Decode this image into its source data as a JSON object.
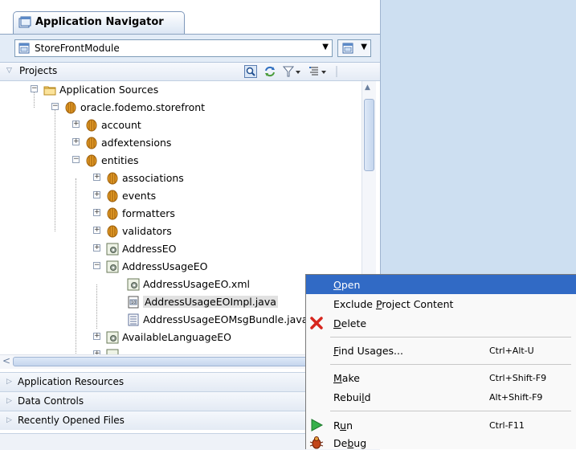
{
  "navigator": {
    "tab_title": "Application Navigator",
    "module": "StoreFrontModule",
    "projects_label": "Projects"
  },
  "tree": [
    {
      "label": "Application Sources",
      "icon": "folder-icon",
      "expanded": true
    },
    {
      "label": "oracle.fodemo.storefront",
      "icon": "package-icon",
      "expanded": true
    },
    {
      "label": "account",
      "icon": "package-icon",
      "expanded": false
    },
    {
      "label": "adfextensions",
      "icon": "package-icon",
      "expanded": false
    },
    {
      "label": "entities",
      "icon": "package-icon",
      "expanded": true
    },
    {
      "label": "associations",
      "icon": "package-icon",
      "expanded": false
    },
    {
      "label": "events",
      "icon": "package-icon",
      "expanded": false
    },
    {
      "label": "formatters",
      "icon": "package-icon",
      "expanded": false
    },
    {
      "label": "validators",
      "icon": "package-icon",
      "expanded": false
    },
    {
      "label": "AddressEO",
      "icon": "entity-object-icon",
      "expanded": false
    },
    {
      "label": "AddressUsageEO",
      "icon": "entity-object-icon",
      "expanded": true
    },
    {
      "label": "AddressUsageEO.xml",
      "icon": "xml-file-icon"
    },
    {
      "label": "AddressUsageEOImpl.java",
      "icon": "java-file-icon",
      "selected": true
    },
    {
      "label": "AddressUsageEOMsgBundle.java",
      "icon": "bundle-file-icon"
    },
    {
      "label": "AvailableLanguageEO",
      "icon": "entity-object-icon",
      "expanded": false
    },
    {
      "label": "...",
      "icon": "entity-object-icon",
      "expanded": false
    }
  ],
  "accordion": [
    {
      "label": "Application Resources"
    },
    {
      "label": "Data Controls"
    },
    {
      "label": "Recently Opened Files"
    }
  ],
  "context_menu": {
    "items": [
      {
        "label": "Open",
        "mnemonic": "O",
        "highlighted": true
      },
      {
        "label": "Exclude Project Content",
        "mnemonic": "P"
      },
      {
        "label": "Delete",
        "mnemonic": "D",
        "icon": "delete-icon"
      },
      {
        "label": "Find Usages...",
        "mnemonic": "F",
        "shortcut": "Ctrl+Alt-U"
      },
      {
        "label": "Make",
        "mnemonic": "M",
        "shortcut": "Ctrl+Shift-F9"
      },
      {
        "label": "Rebuild",
        "mnemonic": "l",
        "shortcut": "Alt+Shift-F9"
      },
      {
        "label": "Run",
        "mnemonic": "u",
        "shortcut": "Ctrl-F11",
        "icon": "run-icon"
      },
      {
        "label": "Debug",
        "mnemonic": "b",
        "icon": "debug-icon"
      }
    ]
  },
  "colors": {
    "selection": "#316ac5",
    "background_right": "#cddff1",
    "package_orange": "#e39b27"
  }
}
